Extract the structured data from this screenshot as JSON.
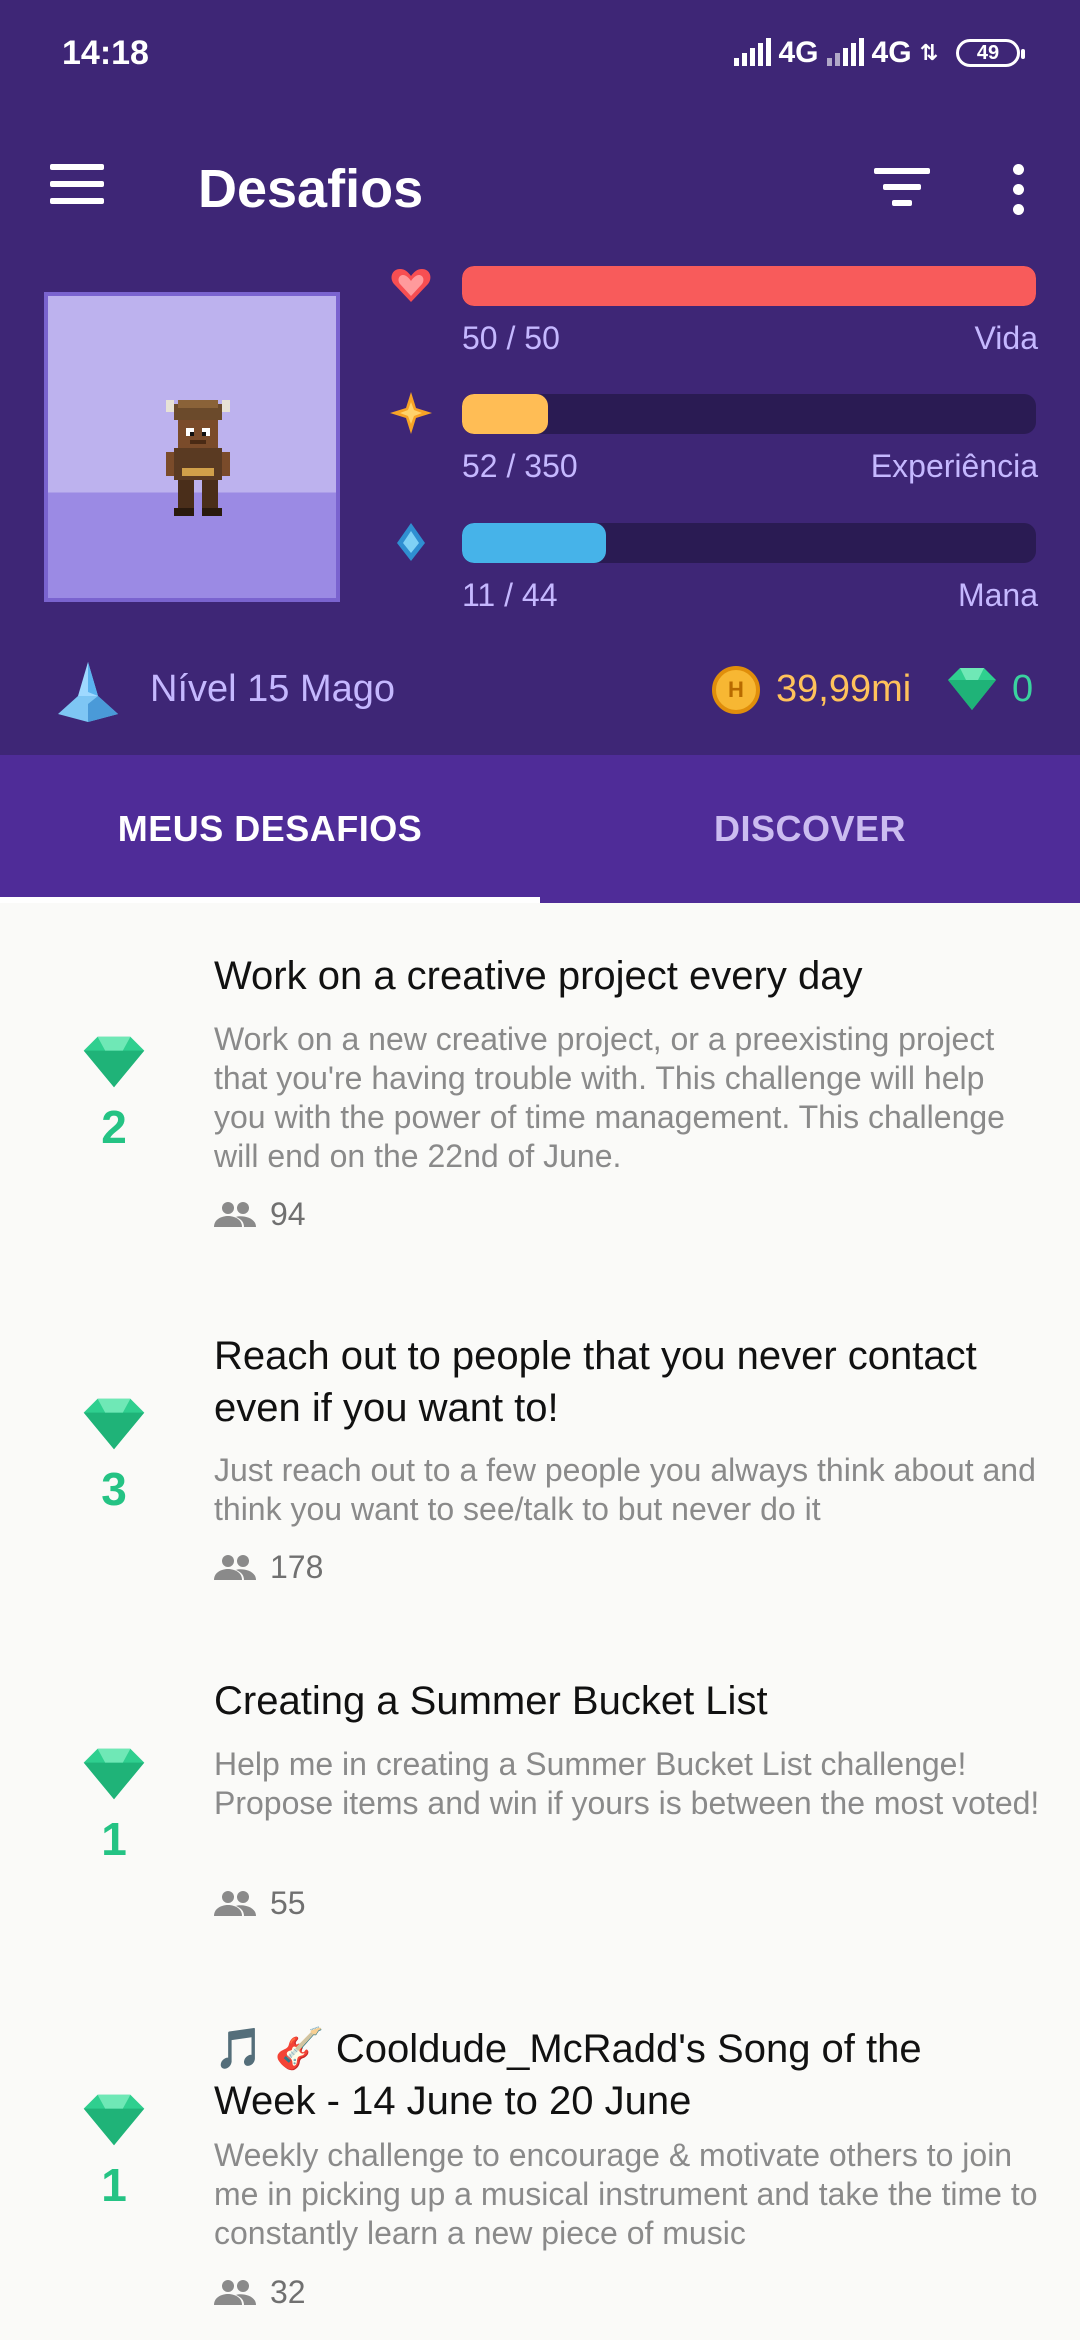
{
  "status_bar": {
    "time": "14:18",
    "network_1": "4G",
    "network_2": "4G",
    "battery": "49"
  },
  "toolbar": {
    "title": "Desafios"
  },
  "stats": [
    {
      "icon": "heart-icon",
      "value": "50 / 50",
      "label": "Vida",
      "fill": 1.0,
      "color": "#f85b5b"
    },
    {
      "icon": "star-icon",
      "value": "52 / 350",
      "label": "Experiência",
      "fill": 0.149,
      "color": "#ffbd55"
    },
    {
      "icon": "drop-icon",
      "value": "11 / 44",
      "label": "Mana",
      "fill": 0.25,
      "color": "#46b3e9"
    }
  ],
  "level": {
    "text": "Nível 15 Mago"
  },
  "currency": {
    "gold": "39,99mi",
    "gems": "0"
  },
  "tabs": [
    {
      "label": "MEUS DESAFIOS",
      "active": true
    },
    {
      "label": "DISCOVER",
      "active": false
    }
  ],
  "challenges": [
    {
      "gems": "2",
      "title": "Work on a creative project every day",
      "description": "Work on a new creative project, or a preexisting project that you're having trouble with. This challenge will help you with the power of time management. This challenge will end on the 22nd of June.",
      "members": "94"
    },
    {
      "gems": "3",
      "title": "Reach out to people that you never contact even if you want to!",
      "description": "Just reach out to a few people you always think about and think you want to see/talk to but never do it",
      "members": "178"
    },
    {
      "gems": "1",
      "title": "Creating a Summer Bucket List",
      "description": "Help me in creating a Summer Bucket List challenge! Propose items and win if yours is between the most voted!",
      "members": "55"
    },
    {
      "gems": "1",
      "title": "🎵 🎸 Cooldude_McRadd's Song of the Week - 14 June to 20 June",
      "description": "Weekly challenge to encourage & motivate others to join me in picking up a musical instrument and take the time to constantly learn a new piece of music",
      "members": "32"
    }
  ],
  "colors": {
    "header_bg": "#3e2676",
    "tabs_bg": "#4f2c98",
    "accent_gem": "#24c384"
  }
}
